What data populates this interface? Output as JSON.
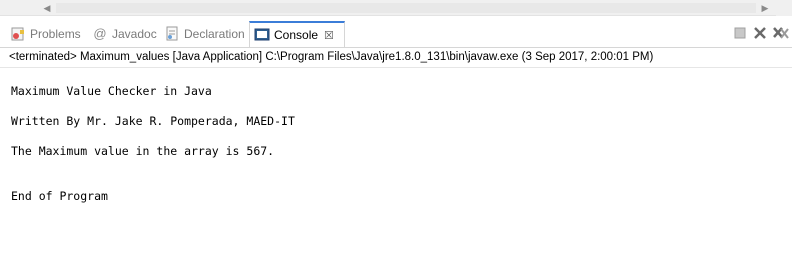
{
  "tabs": [
    {
      "label": "Problems",
      "icon": "problems-icon"
    },
    {
      "label": "Javadoc",
      "icon": "javadoc-icon"
    },
    {
      "label": "Declaration",
      "icon": "declaration-icon"
    },
    {
      "label": "Console",
      "icon": "console-icon",
      "active": true
    }
  ],
  "tab_close_glyph": "☒",
  "status_line": "<terminated> Maximum_values [Java Application] C:\\Program Files\\Java\\jre1.8.0_131\\bin\\javaw.exe (3 Sep 2017, 2:00:01 PM)",
  "console_lines": [
    "Maximum Value Checker in Java",
    "Written By Mr. Jake R. Pomperada, MAED-IT",
    "The Maximum value in the array is 567.",
    "End of Program"
  ],
  "colors": {
    "active_tab_accent": "#3b7dd8",
    "terminate_red": "#c8c8c8",
    "inactive_text": "#7a7a7a"
  }
}
